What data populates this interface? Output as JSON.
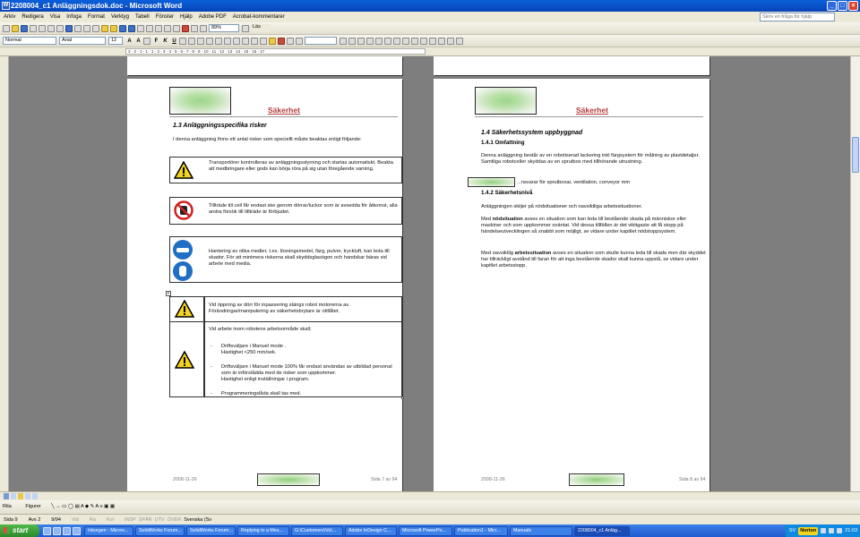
{
  "window": {
    "title": "2208004_c1 Anläggningsdok.doc - Microsoft Word",
    "icon": "word-icon"
  },
  "menu": [
    "Arkiv",
    "Redigera",
    "Visa",
    "Infoga",
    "Format",
    "Verktyg",
    "Tabell",
    "Fönster",
    "Hjälp",
    "Adobe PDF",
    "Acrobat-kommentarer"
  ],
  "ask_placeholder": "Skriv en fråga för hjälp",
  "formatting": {
    "style": "Normal",
    "font": "Arial",
    "size": "12",
    "zoom": "89%",
    "read_label": "Läs"
  },
  "drawing": {
    "draw_label": "Rita",
    "shapes_label": "Figurer"
  },
  "status": {
    "page": "Sida 9",
    "section": "Avs 2",
    "pages": "9/94",
    "at": "Vid",
    "line": "Ra",
    "col": "Kol",
    "rec": "INSP",
    "trk": "SPÅR",
    "ext": "UTV",
    "ovr": "ÖVER",
    "language": "Svenska (Sv"
  },
  "ruler_text": "3 · 2 · 1 · 1 · 1 · 2 · 3 · 4 · 5 · 6 · 7 · 8 · 9 · 10 · 11 · 12 · 13 · 14 · 15 · 16 · 17",
  "page_left": {
    "header": "Säkerhet",
    "heading": "1.3  Anläggningsspecifika risker",
    "intro": "I denna anläggning finns ett antal risker som speciellt måste beaktas enligt följande:",
    "risks": [
      {
        "icon": "warning-icon",
        "text": "Transportörer kontrolleras av anläggningsstyrning och startas automatiskt. Beakta att medbringare eller gods kan börja röra på sig utan föregående varning."
      },
      {
        "icon": "no-hand-icon",
        "text": "Tillträde till cell får endast ske genom dörrar/luckor som är avsedda för åtkomst, alla andra försök till tillträde är förbjudet."
      },
      {
        "icon": "protective-gear-icon",
        "text": "Hantering av olika medier, t.ex. lösningsmedel, färg, pulver, tryckluft, kan leda till skador. För att minimera riskerna skall skyddsglasögon och handskar bäras vid arbete med media."
      }
    ],
    "table": {
      "row1": "Vid öppning av dörr för inpassering stängs robot motorerna av. Förändringar/manipulering av säkerhetsbrytare är otillåtet.",
      "row2_intro": "Vid arbete inom robotens arbetsområde skall;",
      "items": [
        "Driftsväljare i Manuel mode  .\nHastighet <250 mm/sek.",
        "Driftsväljare i Manuel mode 100%  får endast användas av utbildad personal som är införstådda med de risker som uppkommer.\nHastighet enligt inställningar i program.",
        "Programmeringslåda skall tas med."
      ]
    },
    "footer_date": "2008-11-26",
    "footer_page": "Sida 7 av 94"
  },
  "page_right": {
    "header": "Säkerhet",
    "heading": "1.4  Säkerhetssystem uppbyggnad",
    "sub1": "1.4.1  Omfattning",
    "para1": "Denna anläggning består av en robotiserad lackering inkl färgsystem för målning av plastdetaljer. Samtliga robotceller skyddas av en sprutbox med tillhörande utrustning.",
    "para1b": "...nsvarar för sprutboxar, ventilation, conveyor mm",
    "sub2": "1.4.2  Säkerhetsnivå",
    "para2": "Anläggningen skiljer på nödsituationer och oavsiktliga arbetssituationer.",
    "para3_a": "Med ",
    "para3_b": "nödsituation",
    "para3_c": " avses en situation som kan leda till bestående skada på människor eller maskiner och som uppkommer oväntat. Vid dessa tillfällen är det viktigaste att få stopp på händelseutvecklingen så snabbt som möjligt, se vidare under kapitlet nödstoppsystem.",
    "para4_a": "Med oavsiktlig ",
    "para4_b": "arbetssituation",
    "para4_c": " avses en situation som skulle kunna leda till skada men där skyddet har tillräckligt avstånd till faran för att inga bestående skador skall kunna uppstå, se vidare under kapitlet arbetsstopp.",
    "footer_date": "2008-11-26",
    "footer_page": "Sida 8 av 94"
  },
  "taskbar": {
    "start": "start",
    "tasks": [
      "Inkorgen - Micros...",
      "SolidWorks Forum...",
      "SolidWorks Forum...",
      "Replying to a Mes...",
      "G:\\Customers\\Vol...",
      "Adobe InDesign C...",
      "Microsoft PowerPo...",
      "Publication1 - Micr...",
      "Manuals",
      "2208004_c1 Anläg..."
    ],
    "lang": "SV",
    "norton": "Norton",
    "clock": "21:03"
  }
}
